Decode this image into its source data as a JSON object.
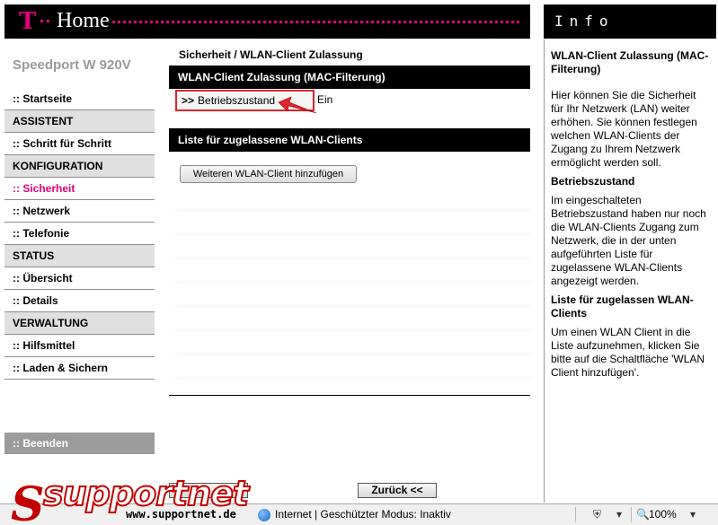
{
  "header": {
    "logo_letter": "T",
    "title": "Home",
    "info_title": "Info"
  },
  "nav": {
    "brand": "Speedport W 920V",
    "items": [
      {
        "label": ":: Startseite",
        "type": "link"
      },
      {
        "label": "ASSISTENT",
        "type": "section"
      },
      {
        "label": ":: Schritt für Schritt",
        "type": "link"
      },
      {
        "label": "KONFIGURATION",
        "type": "section"
      },
      {
        "label": ":: Sicherheit",
        "type": "link",
        "active": true
      },
      {
        "label": ":: Netzwerk",
        "type": "link"
      },
      {
        "label": ":: Telefonie",
        "type": "link"
      },
      {
        "label": "STATUS",
        "type": "section"
      },
      {
        "label": ":: Übersicht",
        "type": "link"
      },
      {
        "label": ":: Details",
        "type": "link"
      },
      {
        "label": "VERWALTUNG",
        "type": "section"
      },
      {
        "label": ":: Hilfsmittel",
        "type": "link"
      },
      {
        "label": ":: Laden & Sichern",
        "type": "link"
      }
    ],
    "logout": ":: Beenden"
  },
  "main": {
    "breadcrumb": "Sicherheit / WLAN-Client Zulassung",
    "section1_title": "WLAN-Client Zulassung (MAC-Filterung)",
    "state_prefix": ">>",
    "state_label": "Betriebszustand",
    "state_value": "Ein",
    "section2_title": "Liste für zugelassene WLAN-Clients",
    "add_button": "Weiteren WLAN-Client hinzufügen",
    "back_button": "Zurück <<"
  },
  "info": {
    "h1": "WLAN-Client Zulassung (MAC-Filterung)",
    "p1": "Hier können Sie die Sicherheit für Ihr Netzwerk (LAN) weiter erhöhen. Sie können festlegen welchen WLAN-Clients der Zugang zu Ihrem Netzwerk ermöglicht werden soll.",
    "h2": "Betriebszustand",
    "p2": "Im eingeschalteten Betriebszustand haben nur noch die WLAN-Clients Zugang zum Netzwerk, die in der unten aufgeführten Liste für zugelassene WLAN-Clients angezeigt werden.",
    "h3": "Liste für zugelassen WLAN-Clients",
    "p3": "Um einen WLAN Client in die Liste aufzunehmen, klicken Sie bitte auf die Schaltfläche 'WLAN Client hinzufügen'."
  },
  "statusbar": {
    "watermark": "supportnet",
    "url": "www.supportnet.de",
    "zone": "Internet | Geschützter Modus: Inaktiv",
    "zoom": "100%"
  },
  "colors": {
    "accent": "#e2007a",
    "highlight_box": "#e0242f",
    "section_bg": "#e0e0e0"
  }
}
